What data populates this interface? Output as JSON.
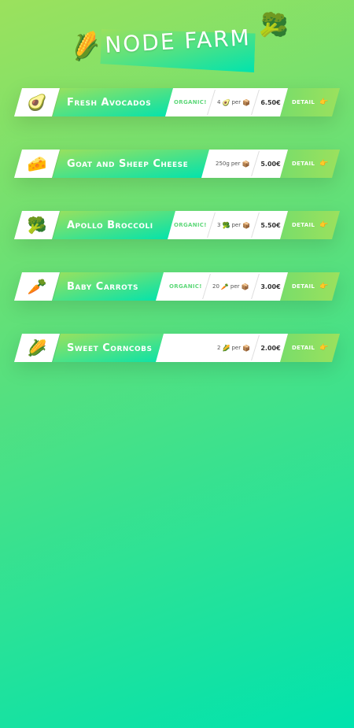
{
  "header": {
    "title": "Node Farm",
    "left_emoji": "🌽",
    "right_emoji": "🥦"
  },
  "products": [
    {
      "emoji": "🥑",
      "name": "Fresh Avocados",
      "organic": "ORGANIC!",
      "qty": "4",
      "qty_emoji": "🥑",
      "per": "per",
      "price": "6.50€",
      "detail": "DETAIL",
      "detail_icon": "👉"
    },
    {
      "emoji": "🧀",
      "name": "Goat and Sheep Cheese",
      "organic": "",
      "qty": "250g",
      "qty_emoji": "",
      "per": "per",
      "price": "5.00€",
      "detail": "DETAIL",
      "detail_icon": "👉"
    },
    {
      "emoji": "🥦",
      "name": "Apollo Broccoli",
      "organic": "ORGANIC!",
      "qty": "3",
      "qty_emoji": "🥦",
      "per": "per",
      "price": "5.50€",
      "detail": "DETAIL",
      "detail_icon": "👉"
    },
    {
      "emoji": "🥕",
      "name": "Baby Carrots",
      "organic": "ORGANIC!",
      "qty": "20",
      "qty_emoji": "🥕",
      "per": "per",
      "price": "3.00€",
      "detail": "DETAIL",
      "detail_icon": "👉"
    },
    {
      "emoji": "🌽",
      "name": "Sweet Corncobs",
      "organic": "",
      "qty": "2",
      "qty_emoji": "🌽",
      "per": "per",
      "price": "2.00€",
      "detail": "DETAIL",
      "detail_icon": "👉"
    }
  ],
  "colors": {
    "accent_start": "#9be15d",
    "accent_end": "#00e3ae",
    "organic": "#5fd87a"
  },
  "per_icon": "📦"
}
